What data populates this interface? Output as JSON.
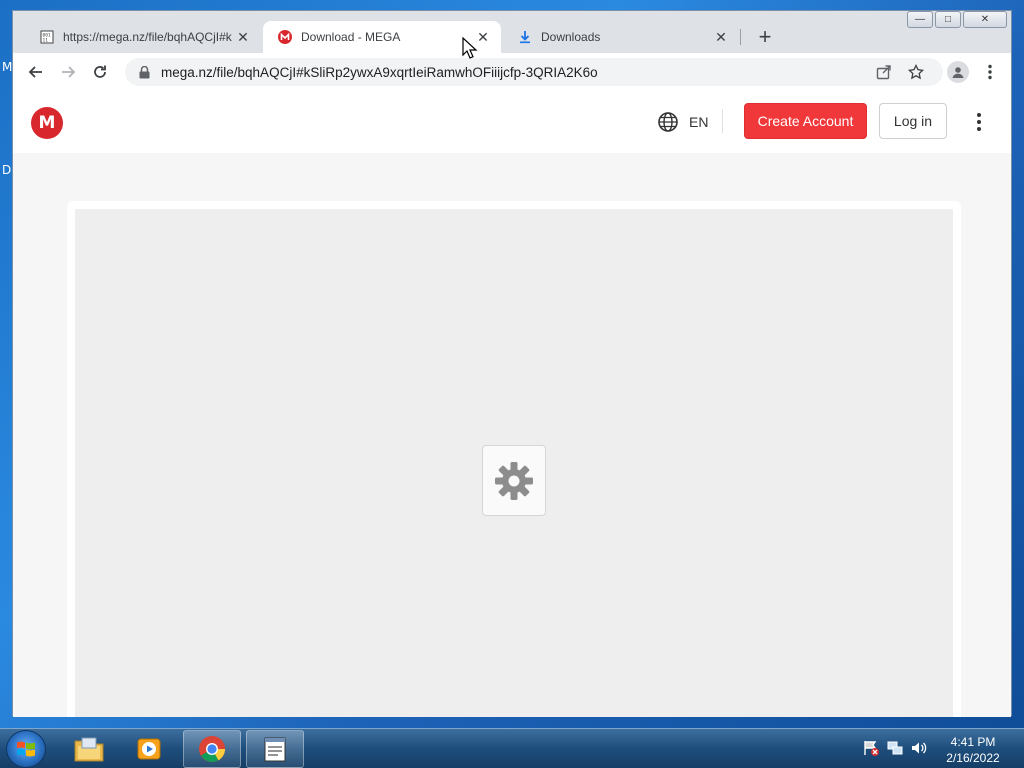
{
  "desktop": {
    "side_letters": [
      "M",
      "D"
    ]
  },
  "browser": {
    "tabs": [
      {
        "title": "https://mega.nz/file/bqhAQCjI#k",
        "favicon": "page-icon",
        "active": false
      },
      {
        "title": "Download - MEGA",
        "favicon": "mega-icon",
        "active": true
      },
      {
        "title": "Downloads",
        "favicon": "download-icon",
        "active": false
      }
    ],
    "tab_close_glyph": "✕",
    "new_tab_glyph": "+",
    "window_buttons": {
      "minimize": "—",
      "maximize": "□",
      "close": "✕"
    },
    "address": {
      "url": "mega.nz/file/bqhAQCjI#kSliRp2ywxA9xqrtIeiRamwhOFiiijcfp-3QRIA2K6o"
    }
  },
  "site": {
    "logo_letter": "M",
    "language": "EN",
    "create_account_label": "Create Account",
    "login_label": "Log in",
    "colors": {
      "brand_red": "#d9272e",
      "button_red": "#f0373a"
    }
  },
  "loader": {
    "icon": "gear-icon"
  },
  "taskbar": {
    "items": [
      "explorer-icon",
      "media-player-icon",
      "chrome-icon",
      "notepad-icon"
    ],
    "clock_time": "4:41 PM",
    "clock_date": "2/16/2022"
  }
}
